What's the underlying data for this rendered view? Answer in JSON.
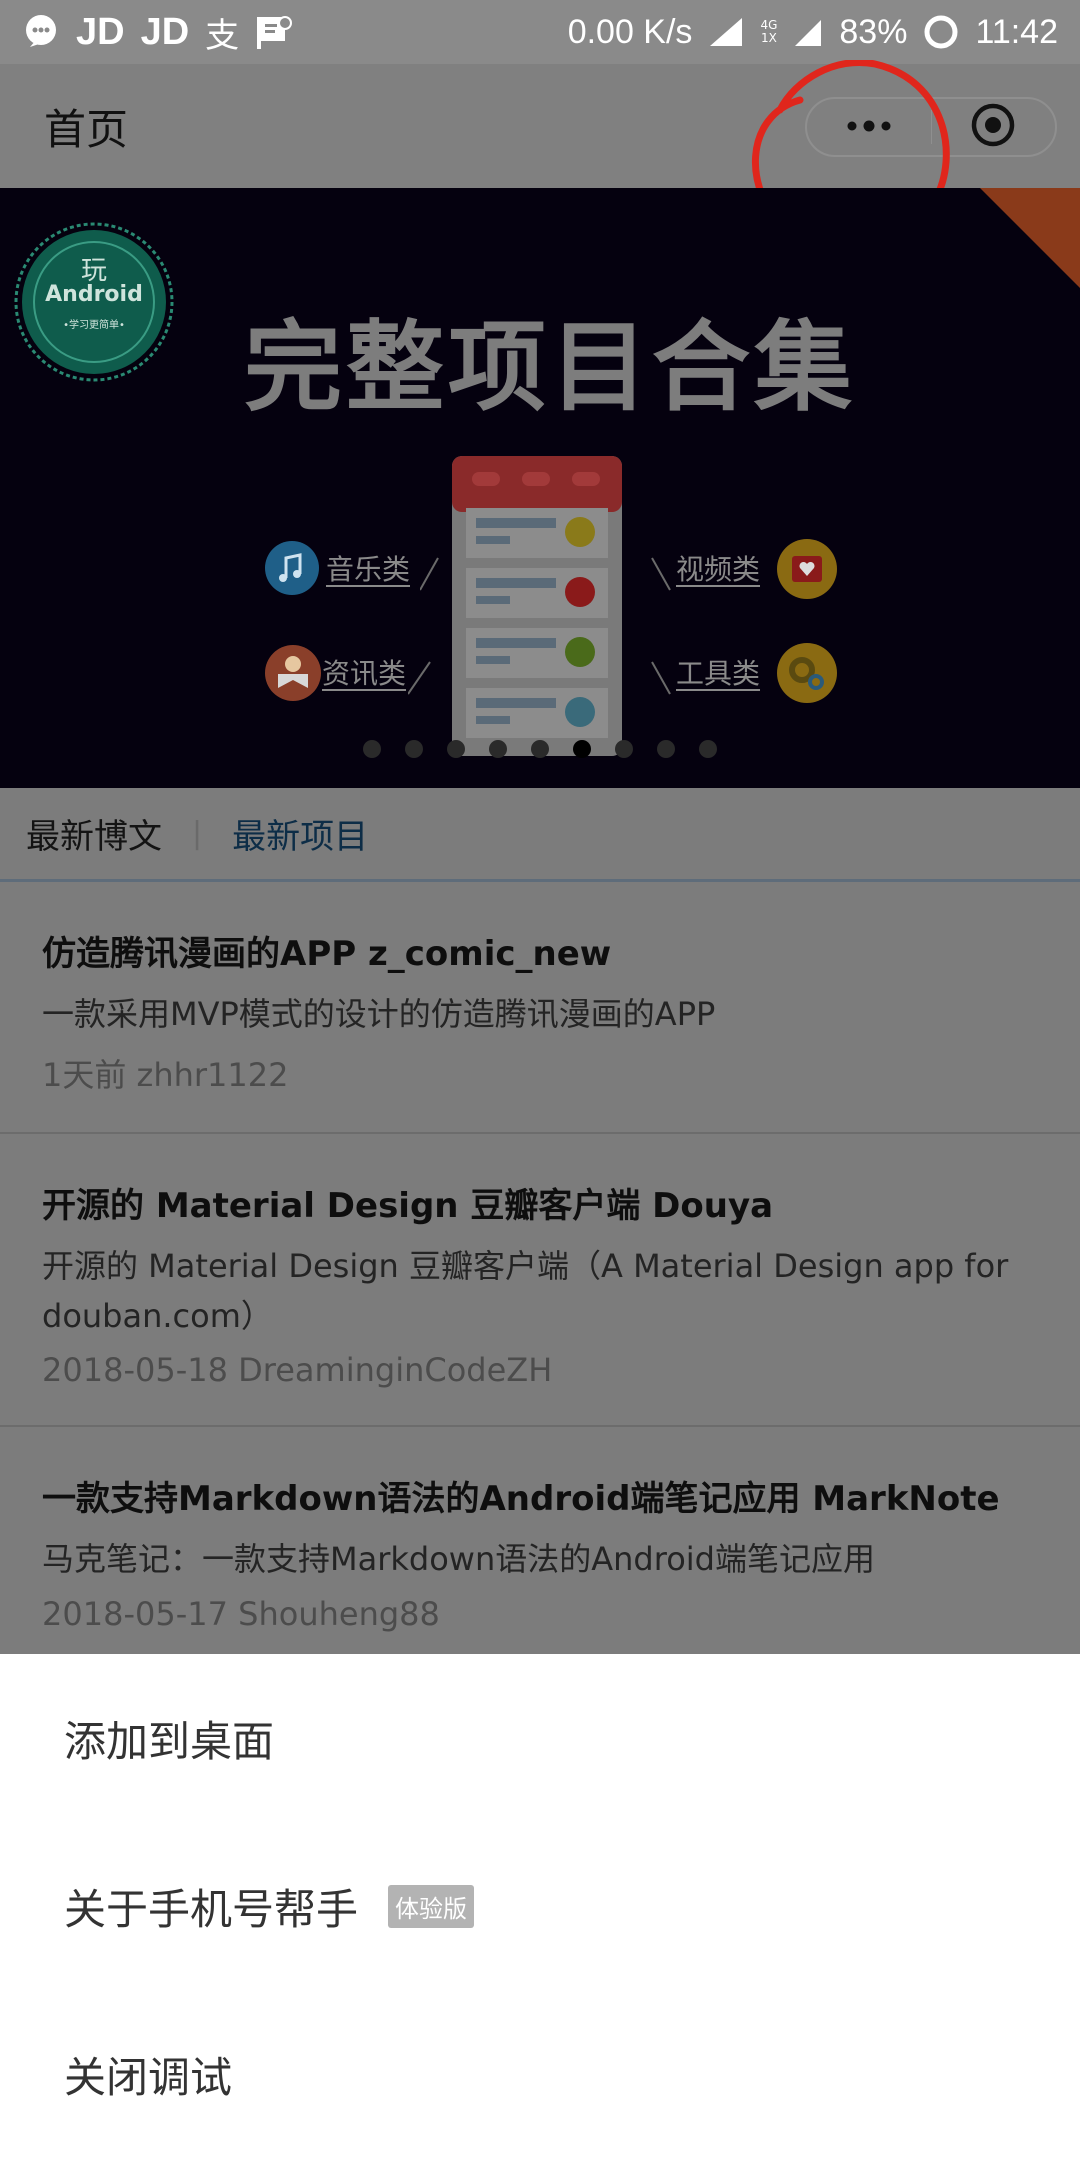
{
  "status_bar": {
    "jd1": "JD",
    "jd2": "JD",
    "alipay": "支",
    "network_speed": "0.00 K/s",
    "net_type_top": "4G",
    "net_type_bottom": "1X",
    "battery": "83%",
    "time": "11:42"
  },
  "nav": {
    "title": "首页",
    "more_icon": "more-dots-icon",
    "close_icon": "target-circle-icon"
  },
  "banner": {
    "title": "完整项目合集",
    "badge_top": "玩",
    "badge_main": "Android",
    "badge_sub": "•学习更简单•",
    "labels": {
      "music": "音乐类",
      "news": "资讯类",
      "video": "视频类",
      "tools": "工具类"
    },
    "carousel_active_index": 5,
    "carousel_count": 9,
    "colors": {
      "background": "#05010f",
      "badge_green": "#0f5c4c",
      "corner_orange": "#8a3a1a"
    }
  },
  "tabs": {
    "latest_posts": "最新博文",
    "latest_projects": "最新项目",
    "active": "latest_projects"
  },
  "items": [
    {
      "title": "仿造腾讯漫画的APP z_comic_new",
      "desc": "一款采用MVP模式的设计的仿造腾讯漫画的APP",
      "meta": "1天前 zhhr1122"
    },
    {
      "title": "开源的 Material Design 豆瓣客户端 Douya",
      "desc": "开源的 Material Design 豆瓣客户端（A Material Design app for douban.com）",
      "meta": "2018-05-18 DreaminginCodeZH"
    },
    {
      "title": "一款支持Markdown语法的Android端笔记应用 MarkNote",
      "desc": "马克笔记：一款支持Markdown语法的Android端笔记应用",
      "meta": "2018-05-17 Shouheng88"
    }
  ],
  "sheet": {
    "add_to_desktop": "添加到桌面",
    "about": "关于手机号帮手",
    "about_tag": "体验版",
    "close_debug": "关闭调试"
  }
}
